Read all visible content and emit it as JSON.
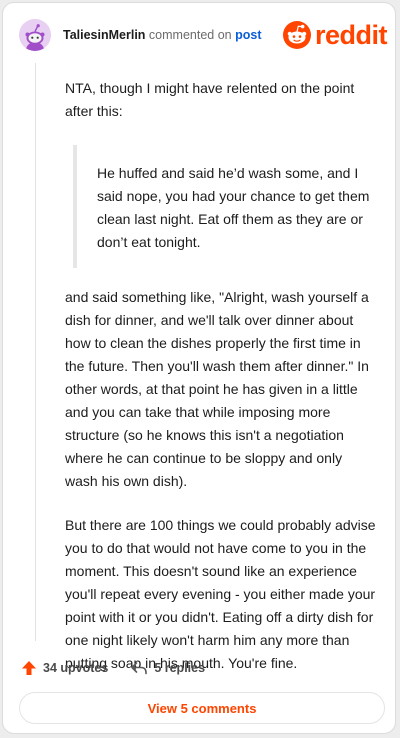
{
  "header": {
    "username": "TaliesinMerlin",
    "action_text": "commented on",
    "link_text": "post",
    "logo_text": "reddit"
  },
  "comment": {
    "intro": "NTA, though I might have relented on the point after this:",
    "quote": "He huffed and said he’d wash some, and I said nope, you had your chance to get them clean last night. Eat off them as they are or don’t eat tonight.",
    "para1": "and said something like, \"Alright, wash yourself a dish for dinner, and we'll talk over dinner about how to clean the dishes properly the first time in the future. Then you'll wash them after dinner.\" In other words, at that point he has given in a little and you can take that while imposing more structure (so he knows this isn't a negotiation where he can continue to be sloppy and only wash his own dish).",
    "para2": "But there are 100 things we could probably advise you to do that would not have come to you in the moment. This doesn't sound like an experience you'll repeat every evening - you either made your point with it or you didn't. Eating off a dirty dish for one night likely won't harm him any more than putting soap in his mouth. You're fine."
  },
  "actions": {
    "upvotes": "34 upvotes",
    "replies": "5 replies"
  },
  "view_button": "View 5 comments",
  "colors": {
    "brand": "#ff4500",
    "link": "#0b5ed7",
    "avatar_bg": "#e8d0f2"
  },
  "icons": [
    "snoo-avatar-icon",
    "reddit-logo-icon",
    "upvote-arrow-icon",
    "reply-arrow-icon"
  ]
}
